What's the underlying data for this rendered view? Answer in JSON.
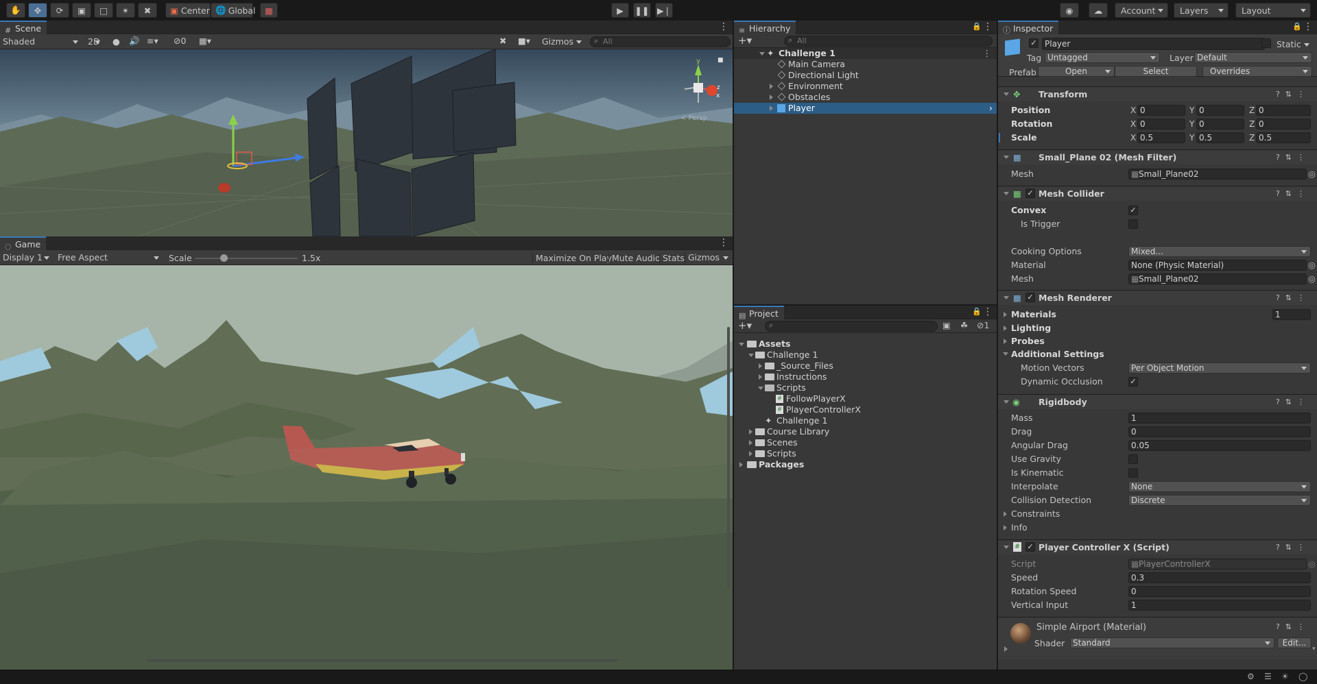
{
  "toolbar": {
    "pivot": "Center",
    "space": "Global",
    "account": "Account",
    "layers": "Layers",
    "layout": "Layout"
  },
  "scene": {
    "tab": "Scene",
    "shading": "Shaded",
    "mode2d": "2D",
    "hidden_count": "0",
    "gizmos": "Gizmos",
    "search_placeholder": "All",
    "persp_label": "< Persp"
  },
  "game": {
    "tab": "Game",
    "display": "Display 1",
    "aspect": "Free Aspect",
    "scale_label": "Scale",
    "scale_value": "1.5x",
    "scale_fraction": 0.28,
    "maximize": "Maximize On Play",
    "mute": "Mute Audio",
    "stats": "Stats",
    "gizmos": "Gizmos"
  },
  "hierarchy": {
    "tab": "Hierarchy",
    "search_placeholder": "All",
    "items": [
      {
        "label": "Challenge 1"
      },
      {
        "label": "Main Camera"
      },
      {
        "label": "Directional Light"
      },
      {
        "label": "Environment"
      },
      {
        "label": "Obstacles"
      },
      {
        "label": "Player"
      }
    ]
  },
  "project": {
    "tab": "Project",
    "hidden_count": "1",
    "items": [
      {
        "label": "Assets"
      },
      {
        "label": "Challenge 1"
      },
      {
        "label": "_Source_Files"
      },
      {
        "label": "Instructions"
      },
      {
        "label": "Scripts"
      },
      {
        "label": "FollowPlayerX"
      },
      {
        "label": "PlayerControllerX"
      },
      {
        "label": "Challenge 1"
      },
      {
        "label": "Course Library"
      },
      {
        "label": "Scenes"
      },
      {
        "label": "Scripts"
      },
      {
        "label": "Packages"
      }
    ]
  },
  "inspector": {
    "tab": "Inspector",
    "object_name": "Player",
    "static_label": "Static",
    "tag_label": "Tag",
    "tag_value": "Untagged",
    "layer_label": "Layer",
    "layer_value": "Default",
    "prefab_label": "Prefab",
    "prefab_open": "Open",
    "prefab_select": "Select",
    "prefab_overrides": "Overrides",
    "transform": {
      "title": "Transform",
      "position_label": "Position",
      "rotation_label": "Rotation",
      "scale_label": "Scale",
      "position": [
        "0",
        "0",
        "0"
      ],
      "rotation": [
        "0",
        "0",
        "0"
      ],
      "scale": [
        "0.5",
        "0.5",
        "0.5"
      ]
    },
    "mesh_filter": {
      "title": "Small_Plane 02 (Mesh Filter)",
      "mesh_label": "Mesh",
      "mesh_value": "Small_Plane02"
    },
    "mesh_collider": {
      "title": "Mesh Collider",
      "convex_label": "Convex",
      "trigger_label": "Is Trigger",
      "cooking_label": "Cooking Options",
      "cooking_value": "Mixed...",
      "material_label": "Material",
      "material_value": "None (Physic Material)",
      "mesh_label": "Mesh",
      "mesh_value": "Small_Plane02"
    },
    "mesh_renderer": {
      "title": "Mesh Renderer",
      "materials_label": "Materials",
      "materials_count": "1",
      "lighting_label": "Lighting",
      "probes_label": "Probes",
      "additional_label": "Additional Settings",
      "motion_label": "Motion Vectors",
      "motion_value": "Per Object Motion",
      "occlusion_label": "Dynamic Occlusion"
    },
    "rigidbody": {
      "title": "Rigidbody",
      "mass_label": "Mass",
      "mass": "1",
      "drag_label": "Drag",
      "drag": "0",
      "angular_label": "Angular Drag",
      "angular": "0.05",
      "gravity_label": "Use Gravity",
      "kinematic_label": "Is Kinematic",
      "interpolate_label": "Interpolate",
      "interpolate": "None",
      "collision_label": "Collision Detection",
      "collision": "Discrete",
      "constraints_label": "Constraints",
      "info_label": "Info"
    },
    "player_controller": {
      "title": "Player Controller X (Script)",
      "script_label": "Script",
      "script_value": "PlayerControllerX",
      "speed_label": "Speed",
      "speed": "0.3",
      "rot_speed_label": "Rotation Speed",
      "rot_speed": "0",
      "vertical_label": "Vertical Input",
      "vertical": "1"
    },
    "material": {
      "title": "Simple Airport (Material)",
      "shader_label": "Shader",
      "shader_value": "Standard",
      "edit_label": "Edit..."
    }
  },
  "colors": {
    "selection": "#2c5d87",
    "accent_tab": "#3a79bb",
    "sky": "#9fc8d8",
    "ground": "#5b6a4a",
    "plane_body": "#b85a52",
    "plane_stripe": "#c9b34a"
  }
}
